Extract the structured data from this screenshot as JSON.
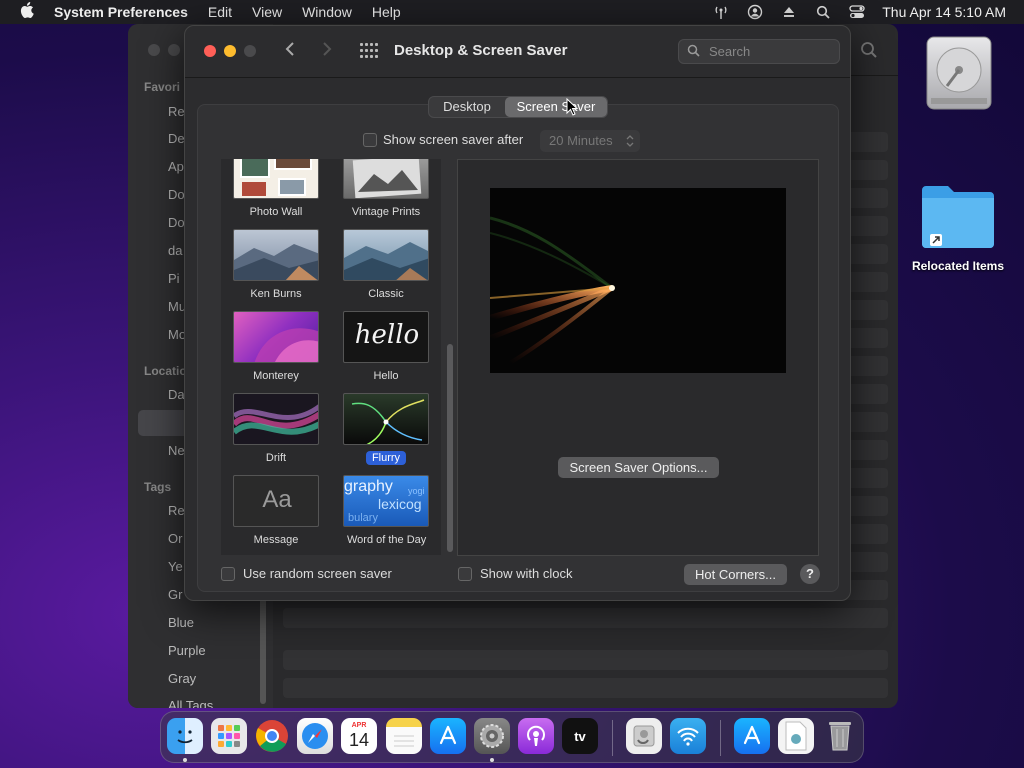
{
  "menubar": {
    "app_name": "System Preferences",
    "items": [
      "Edit",
      "View",
      "Window",
      "Help"
    ],
    "datetime": "Thu Apr 14  5:10 AM"
  },
  "finder_bg": {
    "sidebar_headers": [
      "Favori",
      "Locatio",
      "Tags"
    ],
    "favorites": [
      "Re",
      "De",
      "Ap",
      "Do",
      "Do",
      "da",
      "Pi",
      "Mu",
      "Mo"
    ],
    "locations": [
      "Da",
      "Ne"
    ],
    "tags": [
      "Re",
      "Or",
      "Ye",
      "Gr",
      "Blue",
      "Purple",
      "Gray",
      "All Tags..."
    ]
  },
  "window": {
    "title": "Desktop & Screen Saver",
    "search_placeholder": "Search",
    "tabs": [
      {
        "label": "Desktop",
        "active": false
      },
      {
        "label": "Screen Saver",
        "active": true
      }
    ],
    "show_after_label": "Show screen saver after",
    "show_after_checked": false,
    "minutes_value": "20 Minutes",
    "savers": [
      {
        "label": "Photo Wall",
        "selected": false
      },
      {
        "label": "Vintage Prints",
        "selected": false
      },
      {
        "label": "Ken Burns",
        "selected": false
      },
      {
        "label": "Classic",
        "selected": false
      },
      {
        "label": "Monterey",
        "selected": false
      },
      {
        "label": "Hello",
        "selected": false
      },
      {
        "label": "Drift",
        "selected": false
      },
      {
        "label": "Flurry",
        "selected": true
      },
      {
        "label": "Message",
        "selected": false
      },
      {
        "label": "Word of the Day",
        "selected": false
      }
    ],
    "hello_text": "hello",
    "message_text": "Aa",
    "word_text_1": "graphy",
    "word_text_2": "lexicog",
    "word_text_3": "bulary",
    "word_text_4": "yogi",
    "options_button": "Screen Saver Options...",
    "random_label": "Use random screen saver",
    "clock_label": "Show with clock",
    "hot_corners_button": "Hot Corners...",
    "help_label": "?"
  },
  "desktop": {
    "relocated_label": "Relocated Items"
  },
  "dock": {
    "calendar_month": "APR",
    "calendar_day": "14",
    "tv_label": "tv"
  },
  "colors": {
    "accent": "#2d60d8",
    "close": "#ff5f57",
    "minimize": "#febc2e",
    "zoom": "#4a4a4c"
  }
}
